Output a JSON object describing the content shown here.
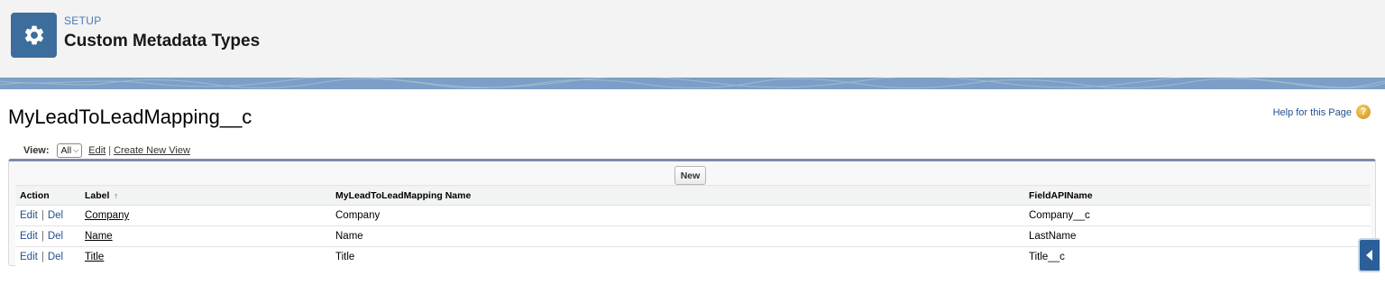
{
  "header": {
    "kicker": "SETUP",
    "title": "Custom Metadata Types",
    "icon": "gear-icon",
    "icon_bg": "#3c6d9c"
  },
  "page": {
    "title": "MyLeadToLeadMapping__c",
    "help_link": "Help for this Page",
    "help_icon": "question-circle-icon"
  },
  "view": {
    "label": "View:",
    "selected": "All",
    "edit_link": "Edit",
    "separator": "|",
    "create_link": "Create New View"
  },
  "list": {
    "new_button": "New",
    "columns": {
      "action": "Action",
      "label": "Label",
      "name": "MyLeadToLeadMapping Name",
      "field": "FieldAPIName"
    },
    "sort_indicator": "↑",
    "edit_label": "Edit",
    "del_label": "Del",
    "action_sep": "|",
    "rows": [
      {
        "label": "Company",
        "name": "Company",
        "field": "Company__c"
      },
      {
        "label": "Name",
        "name": "Name",
        "field": "LastName"
      },
      {
        "label": "Title",
        "name": "Title",
        "field": "Title__c"
      }
    ]
  },
  "colors": {
    "link": "#24508e",
    "band": "#7d9ec6",
    "list_top_border": "#7a8ba8"
  }
}
